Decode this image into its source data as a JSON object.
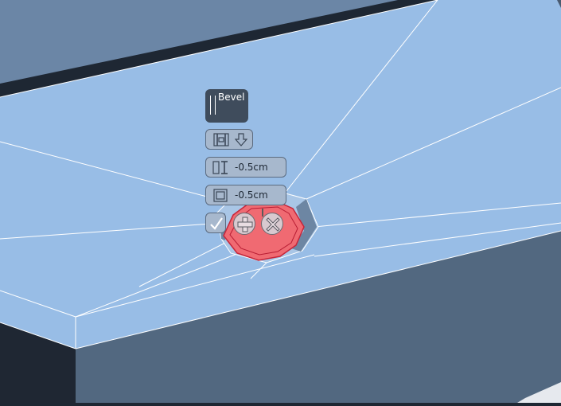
{
  "tool": {
    "title": "Bevel",
    "icon": "bevel-tool-icon"
  },
  "toolbar": {
    "icons": [
      "bevel-mode-icon",
      "direction-arrow-icon"
    ]
  },
  "params": [
    {
      "icon": "offset-height-icon",
      "value": "-0.5cm"
    },
    {
      "icon": "inset-icon",
      "value": "-0.5cm"
    }
  ],
  "actions": [
    "confirm-check-icon",
    "add-plus-icon",
    "cancel-x-icon"
  ],
  "colors": {
    "top_face": "#98bde6",
    "side_face": "#526880",
    "background": "#1e2733",
    "selection": "#f06a72",
    "hud_dark": "#3f4c5c",
    "hud_pill": "#a7b8cd"
  }
}
